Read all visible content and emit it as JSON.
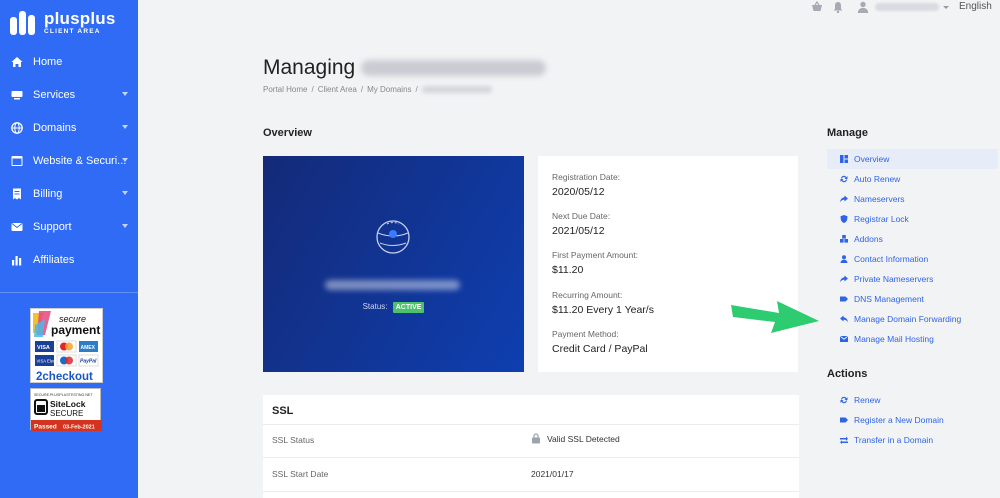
{
  "brand": {
    "name": "plusplus",
    "sub": "CLIENT AREA"
  },
  "nav": [
    {
      "label": "Home",
      "icon": "home-icon",
      "caret": false
    },
    {
      "label": "Services",
      "icon": "server-icon",
      "caret": true
    },
    {
      "label": "Domains",
      "icon": "globe-icon",
      "caret": true
    },
    {
      "label": "Website & Securi...",
      "icon": "window-icon",
      "caret": true
    },
    {
      "label": "Billing",
      "icon": "invoice-icon",
      "caret": true
    },
    {
      "label": "Support",
      "icon": "envelope-icon",
      "caret": true
    },
    {
      "label": "Affiliates",
      "icon": "bar-chart-icon",
      "caret": false
    }
  ],
  "badges": {
    "checkout": {
      "line1": "secure",
      "line2": "payment",
      "brand": "2checkout",
      "cards": [
        "VISA",
        "MC",
        "AMEX",
        "VISA Electron",
        "Maestro",
        "PayPal"
      ]
    },
    "sitelock": {
      "url": "SECURE.PLUSPLUSTESTING.NET",
      "brand": "SiteLock",
      "secure": "SECURE",
      "passed": "Passed",
      "date": "03-Feb-2021"
    }
  },
  "topbar": {
    "language": "English"
  },
  "page": {
    "title": "Managing"
  },
  "breadcrumb": [
    "Portal Home",
    "Client Area",
    "My Domains"
  ],
  "overview": {
    "heading": "Overview",
    "status_label": "Status:",
    "status_value": "ACTIVE",
    "fields": [
      {
        "label": "Registration Date:",
        "value": "2020/05/12"
      },
      {
        "label": "Next Due Date:",
        "value": "2021/05/12"
      },
      {
        "label": "First Payment Amount:",
        "value": "$11.20"
      },
      {
        "label": "Recurring Amount:",
        "value": "$11.20 Every 1 Year/s"
      },
      {
        "label": "Payment Method:",
        "value": "Credit Card / PayPal"
      }
    ]
  },
  "ssl": {
    "heading": "SSL",
    "rows": [
      {
        "label": "SSL Status",
        "value": "Valid SSL Detected"
      },
      {
        "label": "SSL Start Date",
        "value": "2021/01/17"
      }
    ]
  },
  "manage": {
    "heading": "Manage",
    "items": [
      {
        "label": "Overview",
        "icon": "dashboard-icon",
        "active": true
      },
      {
        "label": "Auto Renew",
        "icon": "sync-icon"
      },
      {
        "label": "Nameservers",
        "icon": "share-icon"
      },
      {
        "label": "Registrar Lock",
        "icon": "shield-icon"
      },
      {
        "label": "Addons",
        "icon": "cubes-icon"
      },
      {
        "label": "Contact Information",
        "icon": "user-icon"
      },
      {
        "label": "Private Nameservers",
        "icon": "share-icon"
      },
      {
        "label": "DNS Management",
        "icon": "tag-icon"
      },
      {
        "label": "Manage Domain Forwarding",
        "icon": "reply-icon"
      },
      {
        "label": "Manage Mail Hosting",
        "icon": "mail-icon"
      }
    ]
  },
  "actions": {
    "heading": "Actions",
    "items": [
      {
        "label": "Renew",
        "icon": "sync-icon"
      },
      {
        "label": "Register a New Domain",
        "icon": "tag-icon"
      },
      {
        "label": "Transfer in a Domain",
        "icon": "exchange-icon"
      }
    ]
  },
  "colors": {
    "sidebar": "#2f6bf5",
    "link": "#2f64e9",
    "active_badge": "#4bc26b",
    "arrow": "#2ecc71"
  }
}
